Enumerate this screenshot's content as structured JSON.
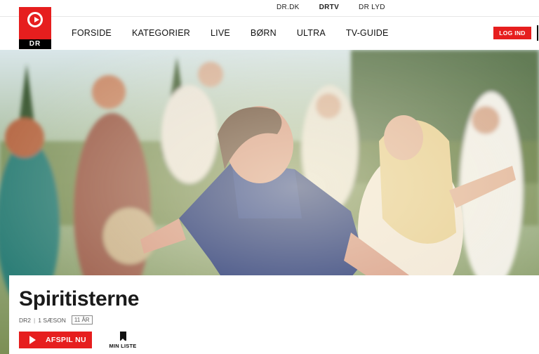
{
  "top_links": [
    "DR.DK",
    "DRTV",
    "DR LYD"
  ],
  "top_active": "DRTV",
  "logo": {
    "text": "DR"
  },
  "nav": [
    "FORSIDE",
    "KATEGORIER",
    "LIVE",
    "BØRN",
    "ULTRA",
    "TV-GUIDE"
  ],
  "login_label": "LOG IND",
  "show": {
    "title": "Spiritisterne",
    "channel": "DR2",
    "seasons": "1 SÆSON",
    "age_rating": "11 ÅR",
    "play_label": "AFSPIL NU",
    "mylist_label": "MIN LISTE"
  },
  "colors": {
    "brand_red": "#e61e1e"
  }
}
